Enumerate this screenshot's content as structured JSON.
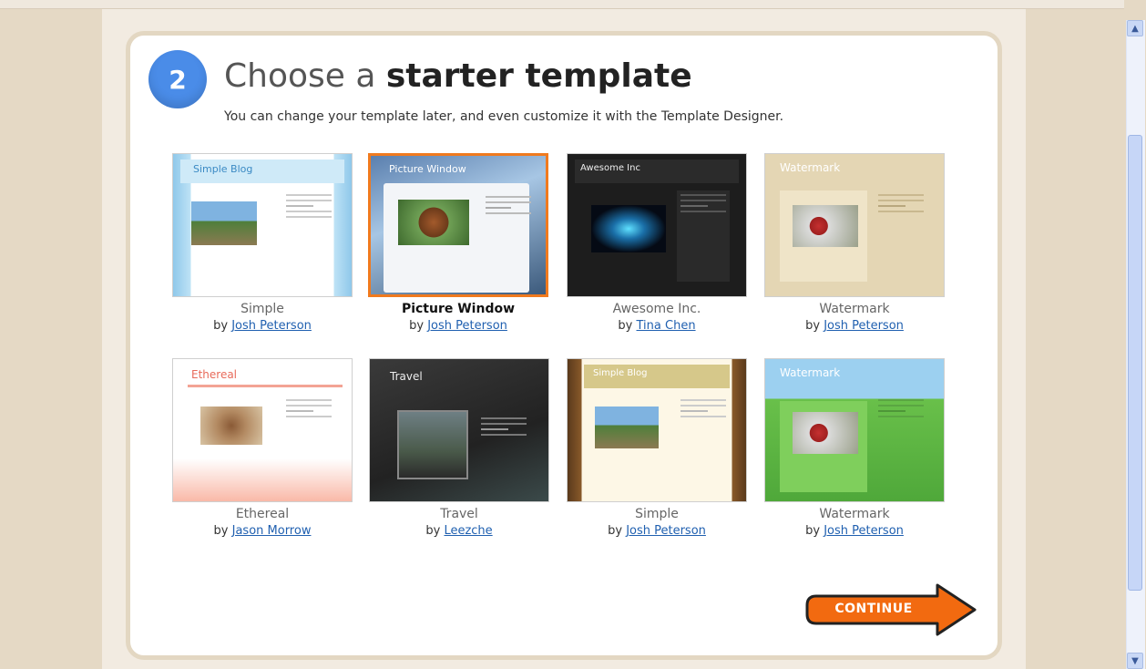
{
  "step": {
    "number": "2"
  },
  "heading": {
    "prefix": "Choose a",
    "bold": "starter template"
  },
  "subheading": "You can change your template later, and even customize it with the Template Designer.",
  "templates": [
    {
      "name": "Simple",
      "by": "by",
      "author": "Josh Peterson",
      "thumb_title": "Simple Blog"
    },
    {
      "name": "Picture Window",
      "by": "by",
      "author": "Josh Peterson",
      "thumb_title": "Picture Window"
    },
    {
      "name": "Awesome Inc.",
      "by": "by",
      "author": "Tina Chen",
      "thumb_title": "Awesome Inc"
    },
    {
      "name": "Watermark",
      "by": "by",
      "author": "Josh Peterson",
      "thumb_title": "Watermark"
    },
    {
      "name": "Ethereal",
      "by": "by",
      "author": "Jason Morrow",
      "thumb_title": "Ethereal"
    },
    {
      "name": "Travel",
      "by": "by",
      "author": "Leezche",
      "thumb_title": "Travel"
    },
    {
      "name": "Simple",
      "by": "by",
      "author": "Josh Peterson",
      "thumb_title": "Simple Blog"
    },
    {
      "name": "Watermark",
      "by": "by",
      "author": "Josh Peterson",
      "thumb_title": "Watermark"
    }
  ],
  "selected_template": "Picture Window",
  "continue_label": "CONTINUE",
  "colors": {
    "accent_blue": "#4a8ce8",
    "continue_orange": "#f26a10",
    "selected_border": "#f07a1e",
    "link": "#2060b0"
  }
}
